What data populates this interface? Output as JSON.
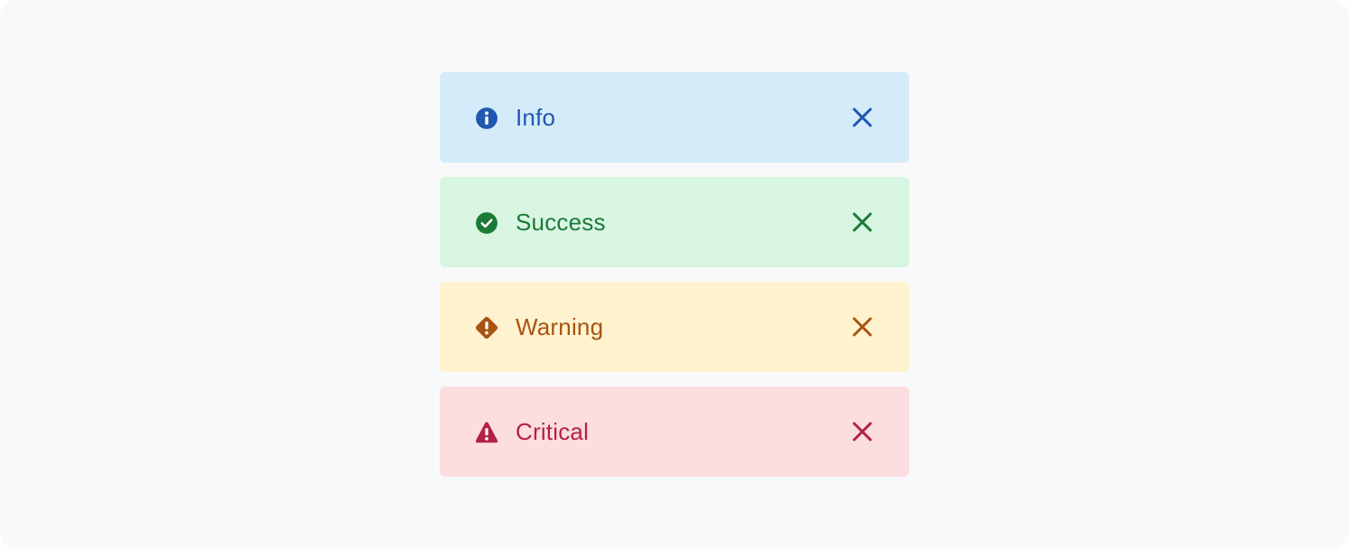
{
  "banners": [
    {
      "variant": "info",
      "label": "Info",
      "icon": "info-circle-icon",
      "close_icon": "close-icon",
      "color": "#1e58b0",
      "background": "#d5ebfa"
    },
    {
      "variant": "success",
      "label": "Success",
      "icon": "check-circle-icon",
      "close_icon": "close-icon",
      "color": "#1b7a35",
      "background": "#d8f5e2"
    },
    {
      "variant": "warning",
      "label": "Warning",
      "icon": "warning-diamond-icon",
      "close_icon": "close-icon",
      "color": "#a85411",
      "background": "#fff2cf"
    },
    {
      "variant": "critical",
      "label": "Critical",
      "icon": "alert-triangle-icon",
      "close_icon": "close-icon",
      "color": "#b32145",
      "background": "#fcdde0"
    }
  ]
}
